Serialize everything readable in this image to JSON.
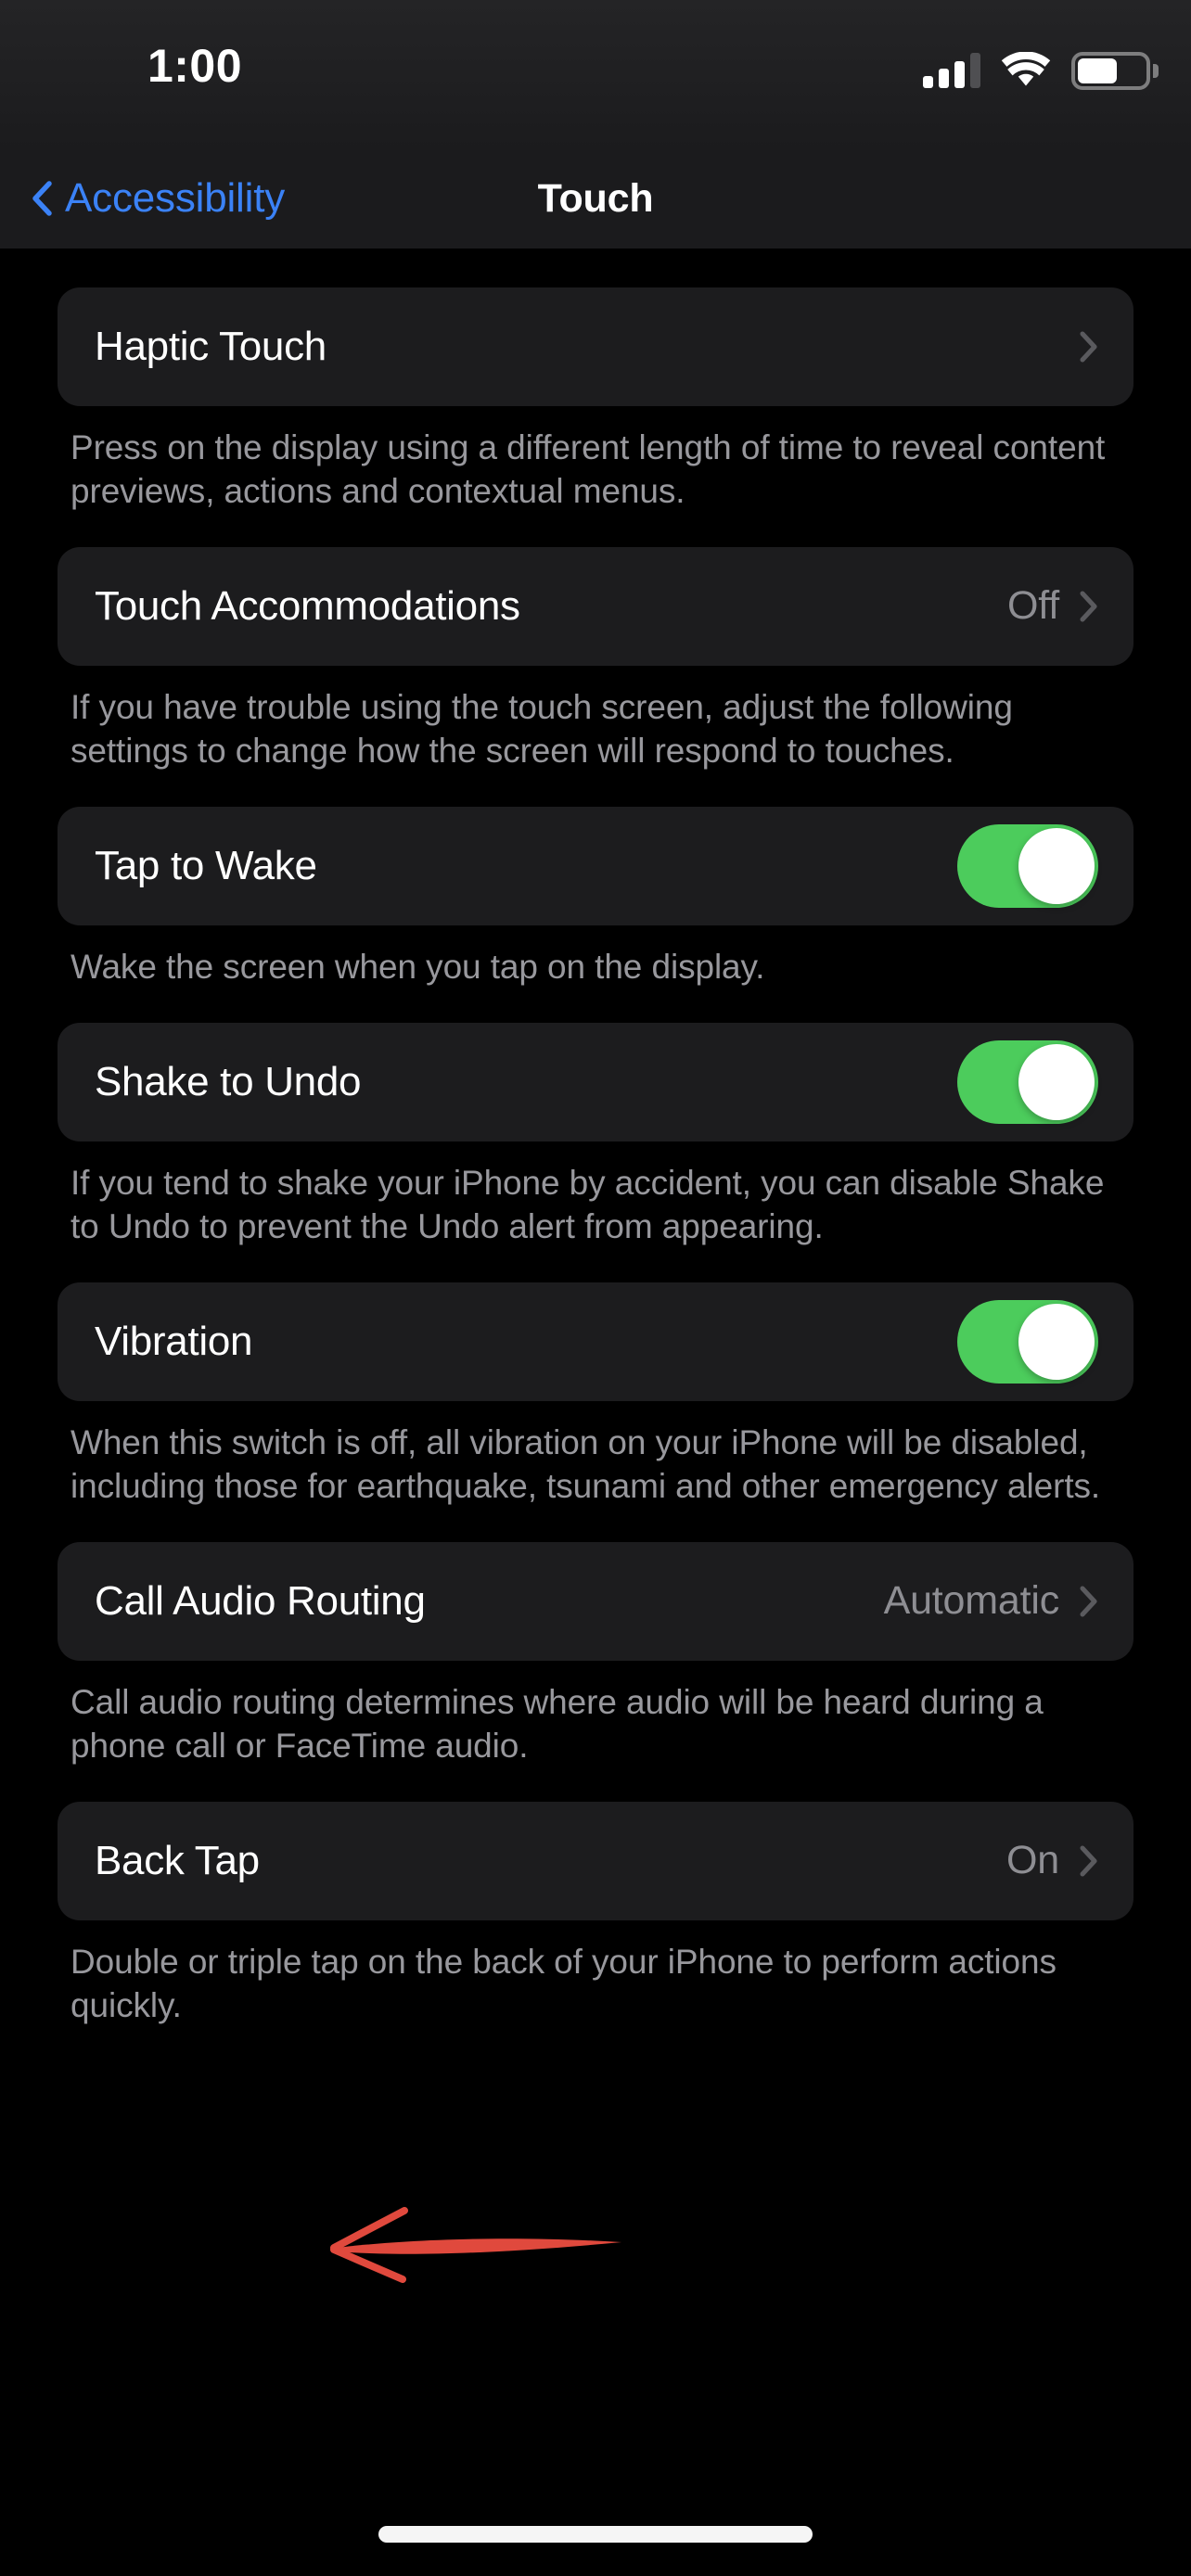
{
  "status_bar": {
    "time": "1:00",
    "cellular_icon": "cellular-signal-icon",
    "cellular_bars_filled": 3,
    "cellular_bars_total": 4,
    "wifi_icon": "wifi-icon",
    "wifi_bars_filled": 3,
    "battery_icon": "battery-icon",
    "battery_level_percent": 60
  },
  "nav_bar": {
    "back_icon": "chevron-left-icon",
    "back_label": "Accessibility",
    "title": "Touch",
    "accent_color": "#3b82f6"
  },
  "theme": {
    "background": "#000000",
    "card_background": "#1c1c1e",
    "primary_text": "#ffffff",
    "secondary_text": "#8e8e93",
    "footer_text": "#98989d",
    "toggle_on_color": "#4ccc5c",
    "chevron_color": "#5a5a5e",
    "annotation_color": "#e0493d"
  },
  "sections": [
    {
      "id": "haptic-touch",
      "label": "Haptic Touch",
      "control": "chevron",
      "value": "",
      "footer": "Press on the display using a different length of time to reveal content previews, actions and contextual menus."
    },
    {
      "id": "touch-accommodations",
      "label": "Touch Accommodations",
      "control": "chevron",
      "value": "Off",
      "footer": "If you have trouble using the touch screen, adjust the following settings to change how the screen will respond to touches."
    },
    {
      "id": "tap-to-wake",
      "label": "Tap to Wake",
      "control": "toggle",
      "value": "on",
      "footer": "Wake the screen when you tap on the display."
    },
    {
      "id": "shake-to-undo",
      "label": "Shake to Undo",
      "control": "toggle",
      "value": "on",
      "footer": "If you tend to shake your iPhone by accident, you can disable Shake to Undo to prevent the Undo alert from appearing."
    },
    {
      "id": "vibration",
      "label": "Vibration",
      "control": "toggle",
      "value": "on",
      "footer": "When this switch is off, all vibration on your iPhone will be disabled, including those for earthquake, tsunami and other emergency alerts."
    },
    {
      "id": "call-audio-routing",
      "label": "Call Audio Routing",
      "control": "chevron",
      "value": "Automatic",
      "footer": "Call audio routing determines where audio will be heard during a phone call or FaceTime audio."
    },
    {
      "id": "back-tap",
      "label": "Back Tap",
      "control": "chevron",
      "value": "On",
      "footer": "Double or triple tap on the back of your iPhone to perform actions quickly."
    }
  ],
  "annotation": {
    "type": "hand-drawn-arrow",
    "direction": "left",
    "points_to": "Back Tap",
    "color": "#e0493d"
  },
  "home_indicator": "home-indicator"
}
